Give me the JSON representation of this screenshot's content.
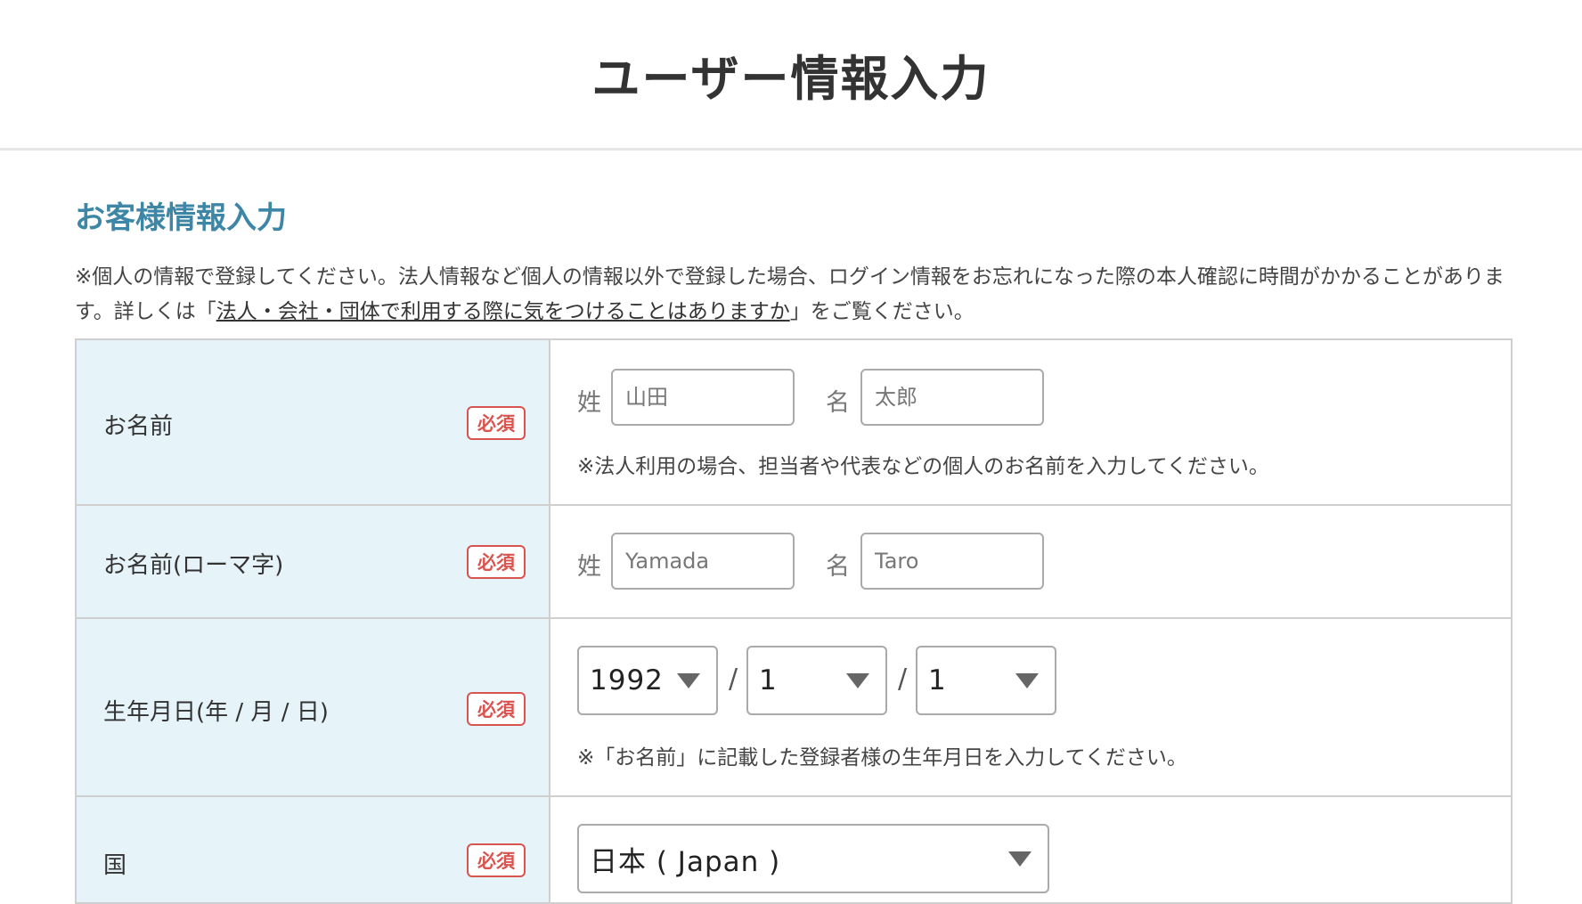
{
  "header": {
    "title": "ユーザー情報入力"
  },
  "section": {
    "title": "お客様情報入力",
    "notice_line1": "※個人の情報で登録してください。法人情報など個人の情報以外で登録した場合、ログイン情報をお忘れになった際の本人確認に時間がかかること",
    "notice_line2_prefix": "があります。詳しくは「",
    "notice_link": "法人・会社・団体で利用する際に気をつけることはありますか",
    "notice_line2_suffix": "」をご覧ください。"
  },
  "required_label": "必須",
  "rows": {
    "name": {
      "label": "お名前",
      "last_label": "姓",
      "last_placeholder": "山田",
      "first_label": "名",
      "first_placeholder": "太郎",
      "hint": "※法人利用の場合、担当者や代表などの個人のお名前を入力してください。"
    },
    "roman": {
      "label": "お名前(ローマ字)",
      "last_label": "姓",
      "last_placeholder": "Yamada",
      "first_label": "名",
      "first_placeholder": "Taro"
    },
    "birth": {
      "label": "生年月日(年 / 月 / 日)",
      "year": "1992",
      "month": "1",
      "day": "1",
      "separator": "/",
      "hint": "※「お名前」に記載した登録者様の生年月日を入力してください。"
    },
    "country": {
      "label": "国",
      "value": "日本 ( Japan )"
    }
  },
  "colors": {
    "section_title": "#3d86a6",
    "label_bg": "#e6f3f9",
    "required": "#d9534f"
  }
}
